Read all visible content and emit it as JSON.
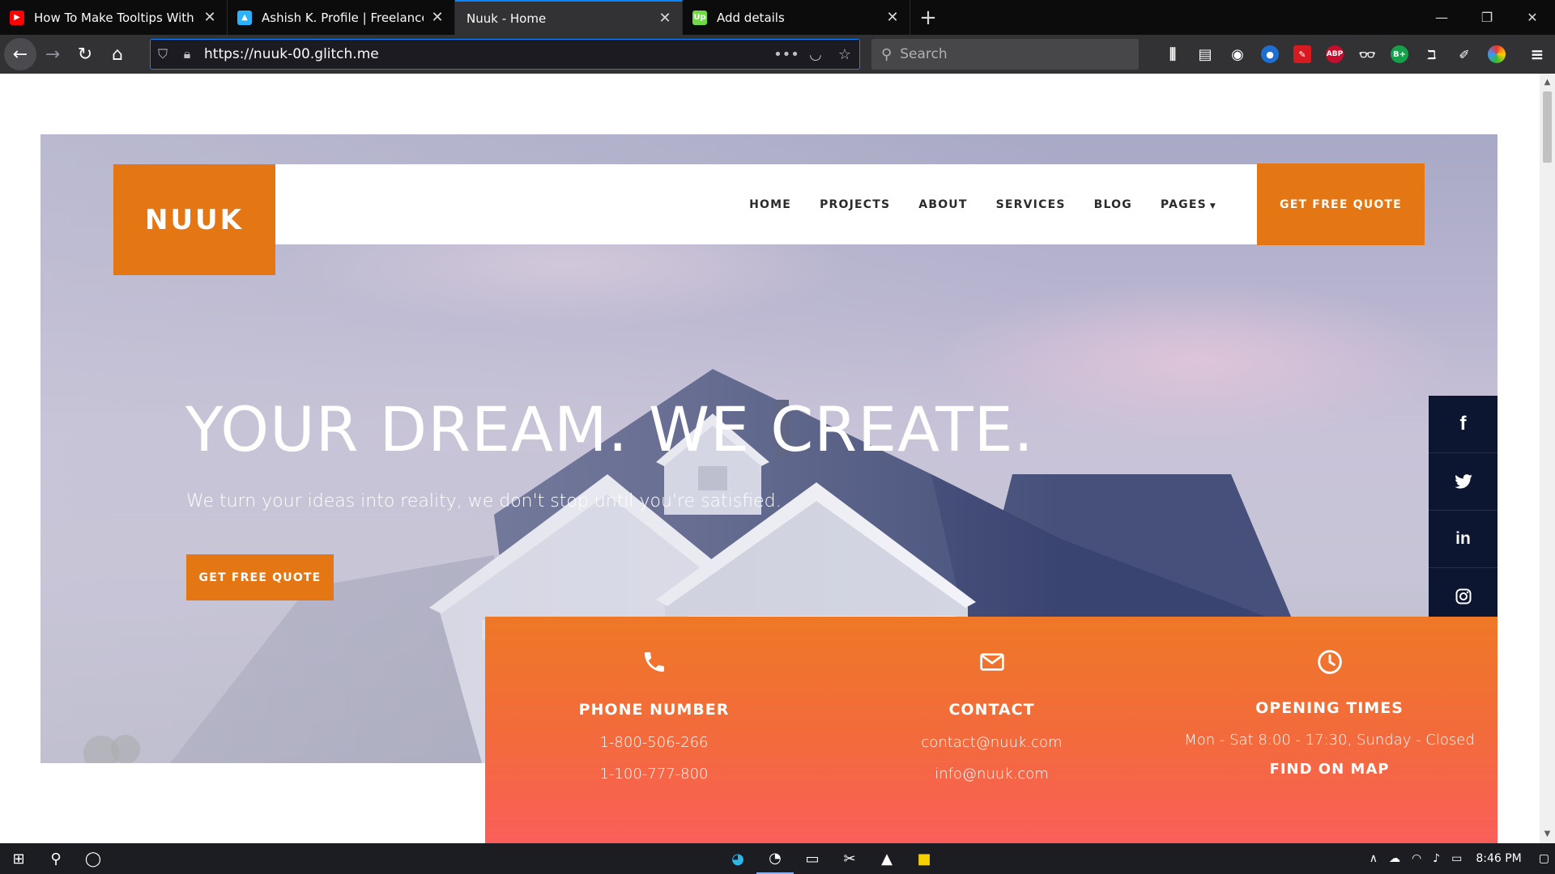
{
  "browser": {
    "tabs": [
      {
        "title": "How To Make Tooltips With On",
        "favicon": "youtube-icon",
        "color": "#ff0000"
      },
      {
        "title": "Ashish K. Profile | Freelancer",
        "favicon": "freelancer-icon",
        "color": "#29b2fe"
      },
      {
        "title": "Nuuk - Home",
        "favicon": "",
        "color": ""
      },
      {
        "title": "Add details",
        "favicon": "upwork-icon",
        "color": "#6fda44"
      }
    ],
    "url": "https://nuuk-00.glitch.me",
    "search_placeholder": "Search",
    "ext_abp": "ABP",
    "ext_b": "B+"
  },
  "site": {
    "logo": "NUUK",
    "nav": [
      "HOME",
      "PROJECTS",
      "ABOUT",
      "SERVICES",
      "BLOG",
      "PAGES"
    ],
    "quote_top": "GET FREE QUOTE",
    "headline": "YOUR DREAM. WE CREATE.",
    "subline": "We turn your ideas into reality, we don't stop until you're satisfied.",
    "quote_hero": "GET FREE QUOTE",
    "social": [
      "facebook-icon",
      "twitter-icon",
      "linkedin-icon",
      "instagram-icon"
    ],
    "info": {
      "phone": {
        "title": "PHONE NUMBER",
        "line1": "1-800-506-266",
        "line2": "1-100-777-800"
      },
      "contact": {
        "title": "CONTACT",
        "line1": "contact@nuuk.com",
        "line2": "info@nuuk.com"
      },
      "hours": {
        "title": "OPENING TIMES",
        "line1": "Mon - Sat 8:00 - 17:30, Sunday - Closed",
        "line2": "FIND ON MAP"
      }
    }
  },
  "taskbar": {
    "time": "8:46 PM"
  },
  "colors": {
    "accent": "#e57614",
    "social_bg": "#0c1630",
    "info_gradient_start": "#ee7826",
    "info_gradient_end": "#fa5e5a"
  }
}
